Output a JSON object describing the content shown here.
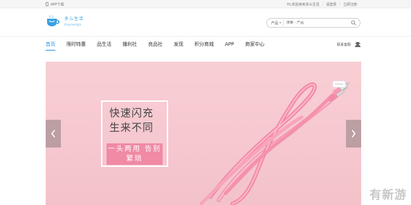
{
  "topbar": {
    "app_download": "APP下载",
    "greeting": "Hi,欢迎来到多么生活",
    "cart": "请登录",
    "account": "立即注册"
  },
  "header": {
    "logo_cn": "多么生活",
    "logo_en": "Duomeshgh",
    "search_scope": "产品",
    "search_placeholder": "搜索 - 产品"
  },
  "nav": {
    "items": [
      {
        "label": "首页",
        "active": true
      },
      {
        "label": "限时特惠",
        "active": false
      },
      {
        "label": "品生活",
        "active": false
      },
      {
        "label": "播利社",
        "active": false
      },
      {
        "label": "良品社",
        "active": false
      },
      {
        "label": "发现",
        "active": false
      },
      {
        "label": "积分商城",
        "active": false
      },
      {
        "label": "APP",
        "active": false
      },
      {
        "label": "商家中心",
        "active": false
      }
    ],
    "contact_label": "联系客服"
  },
  "banner": {
    "headline_1": "快速闪充",
    "headline_2": "生来不同",
    "subline": "一头两用 告别繁琐",
    "background_color": "#f7cad0",
    "accent_color": "#f08aa5"
  },
  "watermark": "有新游",
  "colors": {
    "brand_blue": "#2b8fe0"
  }
}
